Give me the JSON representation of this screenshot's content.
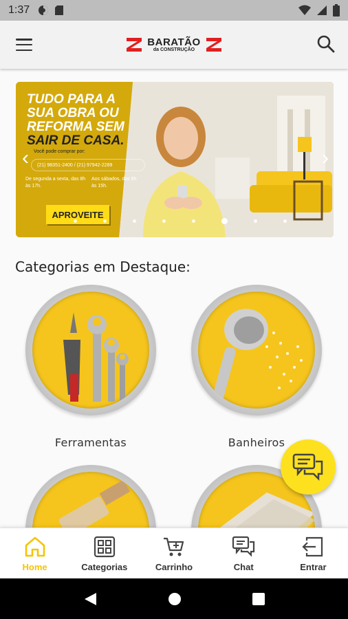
{
  "status_bar": {
    "time": "1:37",
    "icons_left": [
      "data-saver-icon",
      "sd-card-icon"
    ],
    "icons_right": [
      "wifi-icon",
      "signal-icon",
      "battery-icon"
    ]
  },
  "app_bar": {
    "logo_name": "BARATÃO",
    "logo_sub": "da CONSTRUÇÃO",
    "menu_icon": "hamburger-menu-icon",
    "search_icon": "search-icon"
  },
  "banner": {
    "headline_line1": "TUDO PARA A",
    "headline_line2": "SUA OBRA OU",
    "headline_line3": "REFORMA SEM",
    "headline_line4": "SAIR DE CASA.",
    "small_text": "Você pode comprar por:",
    "phones": "(21) 98351-2400 / (21) 97942-2289",
    "hours_weekday": "De segunda a sexta, das 8h às 17h.",
    "hours_saturday": "Aos sábados, das 8h às 15h.",
    "cta": "APROVEITE",
    "prev_arrow": "‹",
    "next_arrow": "›",
    "slide_count": 8,
    "active_slide": 5
  },
  "section": {
    "title": "Categorias em Destaque:"
  },
  "categories": [
    {
      "label": "Ferramentas",
      "icon": "tools-icon"
    },
    {
      "label": "Banheiros",
      "icon": "shower-icon"
    },
    {
      "label": "",
      "icon": "paint-brush-icon"
    },
    {
      "label": "",
      "icon": "tiles-icon"
    }
  ],
  "chat_fab": {
    "icon": "chat-bubbles-icon"
  },
  "bottom_nav": [
    {
      "label": "Home",
      "icon": "home-icon",
      "active": true
    },
    {
      "label": "Categorias",
      "icon": "grid-icon",
      "active": false
    },
    {
      "label": "Carrinho",
      "icon": "cart-icon",
      "active": false
    },
    {
      "label": "Chat",
      "icon": "chat-icon",
      "active": false
    },
    {
      "label": "Entrar",
      "icon": "login-icon",
      "active": false
    }
  ],
  "colors": {
    "accent": "#f5c400",
    "banner_yellow": "#d4a90c",
    "logo_red": "#e02020"
  }
}
